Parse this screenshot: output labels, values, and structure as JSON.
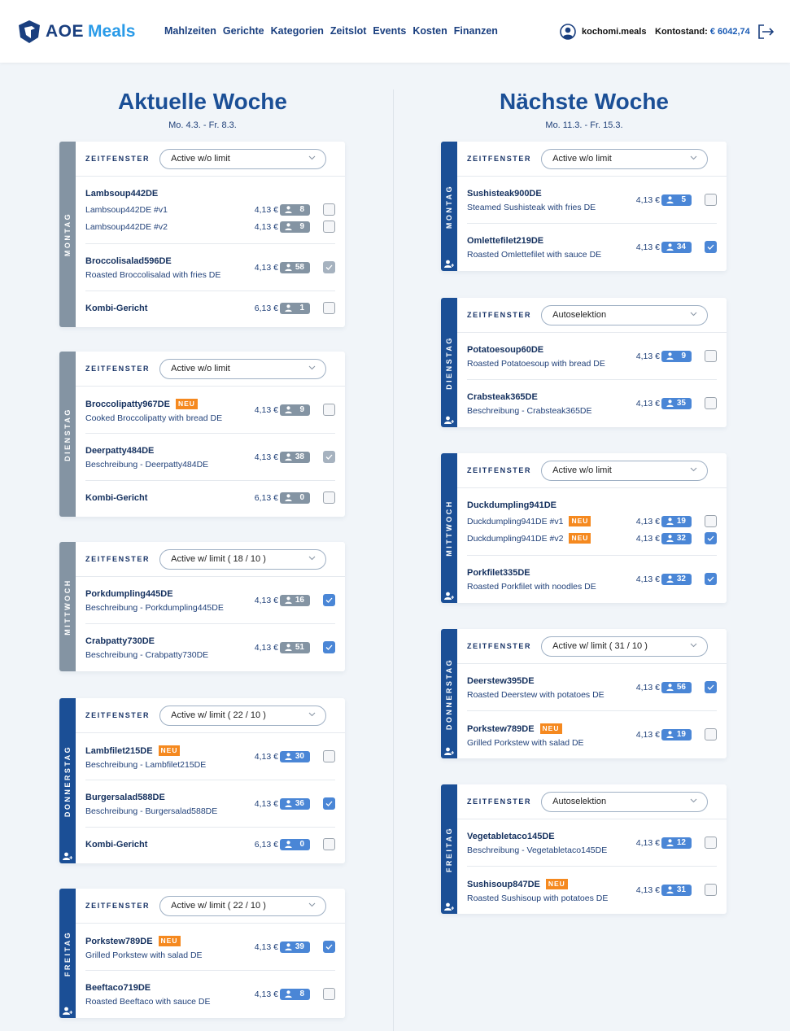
{
  "header": {
    "logo_aoe": "AOE",
    "logo_meals": "Meals",
    "nav": [
      "Mahlzeiten",
      "Gerichte",
      "Kategorien",
      "Zeitslot",
      "Events",
      "Kosten",
      "Finanzen"
    ],
    "username": "kochomi.meals",
    "balance_label": "Kontostand:",
    "balance_value": "€ 6042,74"
  },
  "zeitfenster_label": "ZEITFENSTER",
  "weeks": [
    {
      "title": "Aktuelle Woche",
      "range": "Mo. 4.3. - Fr. 8.3.",
      "days": [
        {
          "label": "MONTAG",
          "active": false,
          "slot": "Active w/o limit",
          "meals": [
            {
              "title": "Lambsoup442DE",
              "variants": [
                {
                  "name": "Lambsoup442DE #v1",
                  "price": "4,13 €",
                  "count": "8",
                  "state": "unchecked"
                },
                {
                  "name": "Lambsoup442DE #v2",
                  "price": "4,13 €",
                  "count": "9",
                  "state": "unchecked"
                }
              ]
            },
            {
              "title": "Broccolisalad596DE",
              "desc": "Roasted Broccolisalad with fries DE",
              "price": "4,13 €",
              "count": "58",
              "state": "checked-disabled"
            },
            {
              "title": "Kombi-Gericht",
              "price": "6,13 €",
              "count": "1",
              "state": "unchecked"
            }
          ]
        },
        {
          "label": "DIENSTAG",
          "active": false,
          "slot": "Active w/o limit",
          "meals": [
            {
              "title": "Broccolipatty967DE",
              "neu": "NEU",
              "desc": "Cooked Broccolipatty with bread DE",
              "price": "4,13 €",
              "count": "9",
              "state": "unchecked"
            },
            {
              "title": "Deerpatty484DE",
              "desc": "Beschreibung - Deerpatty484DE",
              "price": "4,13 €",
              "count": "38",
              "state": "checked-disabled"
            },
            {
              "title": "Kombi-Gericht",
              "price": "6,13 €",
              "count": "0",
              "state": "unchecked"
            }
          ]
        },
        {
          "label": "MITTWOCH",
          "active": false,
          "slot": "Active w/ limit ( 18 / 10 )",
          "meals": [
            {
              "title": "Porkdumpling445DE",
              "desc": "Beschreibung - Porkdumpling445DE",
              "price": "4,13 €",
              "count": "16",
              "state": "checked"
            },
            {
              "title": "Crabpatty730DE",
              "desc": "Beschreibung - Crabpatty730DE",
              "price": "4,13 €",
              "count": "51",
              "state": "checked"
            }
          ]
        },
        {
          "label": "DONNERSTAG",
          "active": true,
          "slot": "Active w/ limit ( 22 / 10 )",
          "meals": [
            {
              "title": "Lambfilet215DE",
              "neu": "NEU",
              "desc": "Beschreibung - Lambfilet215DE",
              "price": "4,13 €",
              "count": "30",
              "state": "unchecked"
            },
            {
              "title": "Burgersalad588DE",
              "desc": "Beschreibung - Burgersalad588DE",
              "price": "4,13 €",
              "count": "36",
              "state": "checked"
            },
            {
              "title": "Kombi-Gericht",
              "price": "6,13 €",
              "count": "0",
              "state": "unchecked"
            }
          ]
        },
        {
          "label": "FREITAG",
          "active": true,
          "slot": "Active w/ limit ( 22 / 10 )",
          "meals": [
            {
              "title": "Porkstew789DE",
              "neu": "NEU",
              "desc": "Grilled Porkstew with salad DE",
              "price": "4,13 €",
              "count": "39",
              "state": "checked"
            },
            {
              "title": "Beeftaco719DE",
              "desc": "Roasted Beeftaco with sauce DE",
              "price": "4,13 €",
              "count": "8",
              "state": "unchecked"
            }
          ]
        }
      ]
    },
    {
      "title": "Nächste Woche",
      "range": "Mo. 11.3. - Fr. 15.3.",
      "days": [
        {
          "label": "MONTAG",
          "active": true,
          "slot": "Active w/o limit",
          "meals": [
            {
              "title": "Sushisteak900DE",
              "desc": "Steamed Sushisteak with fries DE",
              "price": "4,13 €",
              "count": "5",
              "state": "unchecked"
            },
            {
              "title": "Omlettefilet219DE",
              "desc": "Roasted Omlettefilet with sauce DE",
              "price": "4,13 €",
              "count": "34",
              "state": "checked"
            }
          ]
        },
        {
          "label": "DIENSTAG",
          "active": true,
          "slot": "Autoselektion",
          "meals": [
            {
              "title": "Potatoesoup60DE",
              "desc": "Roasted Potatoesoup with bread DE",
              "price": "4,13 €",
              "count": "9",
              "state": "unchecked"
            },
            {
              "title": "Crabsteak365DE",
              "desc": "Beschreibung - Crabsteak365DE",
              "price": "4,13 €",
              "count": "35",
              "state": "unchecked"
            }
          ]
        },
        {
          "label": "MITTWOCH",
          "active": true,
          "slot": "Active w/o limit",
          "meals": [
            {
              "title": "Duckdumpling941DE",
              "variants": [
                {
                  "name": "Duckdumpling941DE #v1",
                  "neu": "NEU",
                  "price": "4,13 €",
                  "count": "19",
                  "state": "unchecked"
                },
                {
                  "name": "Duckdumpling941DE #v2",
                  "neu": "NEU",
                  "price": "4,13 €",
                  "count": "32",
                  "state": "checked"
                }
              ]
            },
            {
              "title": "Porkfilet335DE",
              "desc": "Roasted Porkfilet with noodles DE",
              "price": "4,13 €",
              "count": "32",
              "state": "checked"
            }
          ]
        },
        {
          "label": "DONNERSTAG",
          "active": true,
          "slot": "Active w/ limit ( 31 / 10 )",
          "meals": [
            {
              "title": "Deerstew395DE",
              "desc": "Roasted Deerstew with potatoes DE",
              "price": "4,13 €",
              "count": "56",
              "state": "checked"
            },
            {
              "title": "Porkstew789DE",
              "neu": "NEU",
              "desc": "Grilled Porkstew with salad DE",
              "price": "4,13 €",
              "count": "19",
              "state": "unchecked"
            }
          ]
        },
        {
          "label": "FREITAG",
          "active": true,
          "slot": "Autoselektion",
          "meals": [
            {
              "title": "Vegetabletaco145DE",
              "desc": "Beschreibung - Vegetabletaco145DE",
              "price": "4,13 €",
              "count": "12",
              "state": "unchecked"
            },
            {
              "title": "Sushisoup847DE",
              "neu": "NEU",
              "desc": "Roasted Sushisoup with potatoes DE",
              "price": "4,13 €",
              "count": "31",
              "state": "unchecked"
            }
          ]
        }
      ]
    }
  ]
}
